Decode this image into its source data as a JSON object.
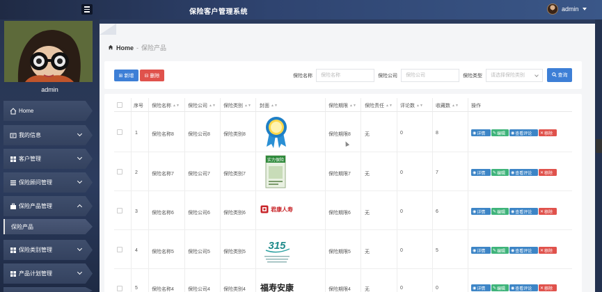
{
  "header": {
    "title": "保险客户管理系统",
    "user": "admin"
  },
  "sidebar": {
    "username": "admin",
    "items": [
      {
        "label": "Home",
        "icon": "home-icon"
      },
      {
        "label": "我的信息",
        "icon": "id-card-icon"
      },
      {
        "label": "客户管理",
        "icon": "grid-icon"
      },
      {
        "label": "保险顾问管理",
        "icon": "list-icon"
      },
      {
        "label": "保险产品管理",
        "icon": "briefcase-icon",
        "expanded": true
      },
      {
        "label": "保险类别管理",
        "icon": "grid-icon"
      },
      {
        "label": "产品计划管理",
        "icon": "grid-icon"
      }
    ],
    "sub_item": "保险产品"
  },
  "breadcrumb": {
    "home": "Home",
    "separator": "-",
    "current": "保险产品"
  },
  "toolbar": {
    "add_label": "新增",
    "delete_label": "删除",
    "search_label": "查询"
  },
  "search": {
    "name_label": "保险名称",
    "name_placeholder": "保险名称",
    "company_label": "保险公司",
    "company_placeholder": "保险公司",
    "category_label": "保险类型",
    "category_placeholder": "请选择保险类别"
  },
  "table": {
    "headers": [
      "序号",
      "保险名称",
      "保险公司",
      "保险类别",
      "封面",
      "保险期限",
      "保险责任",
      "评论数",
      "收藏数",
      "操作"
    ],
    "rows": [
      {
        "no": "1",
        "name": "保险名称8",
        "company": "保险公司8",
        "category": "保险类别8",
        "cover": "award-badge",
        "term": "保险期限8",
        "liability": "无",
        "comments": "0",
        "favorites": "8"
      },
      {
        "no": "2",
        "name": "保险名称7",
        "company": "保险公司7",
        "category": "保险类别7",
        "cover": "book-cover",
        "cover_text": "实力保险",
        "term": "保险期限7",
        "liability": "无",
        "comments": "0",
        "favorites": "7"
      },
      {
        "no": "3",
        "name": "保险名称6",
        "company": "保险公司6",
        "category": "保险类别6",
        "cover": "logo",
        "cover_text": "君康人寿",
        "term": "保险期限6",
        "liability": "无",
        "comments": "0",
        "favorites": "6"
      },
      {
        "no": "4",
        "name": "保险名称5",
        "company": "保险公司5",
        "category": "保险类别5",
        "cover": "logo-315",
        "cover_text": "315",
        "term": "保险期限5",
        "liability": "无",
        "comments": "0",
        "favorites": "5"
      },
      {
        "no": "5",
        "name": "保险名称4",
        "company": "保险公司4",
        "category": "保险类别4",
        "cover": "text",
        "cover_text": "福寿安康",
        "term": "保险期限4",
        "liability": "无",
        "comments": "0",
        "favorites": "0"
      }
    ],
    "actions": {
      "detail": "详情",
      "edit": "编辑",
      "review": "查看评论",
      "remove": "移除"
    }
  }
}
